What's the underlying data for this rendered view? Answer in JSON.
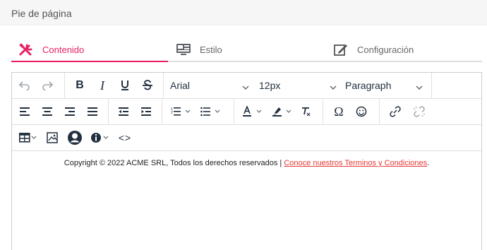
{
  "panel": {
    "title": "Pie de página"
  },
  "tabs": [
    {
      "label": "Contenido",
      "icon": "tools-icon",
      "active": true
    },
    {
      "label": "Estilo",
      "icon": "style-icon",
      "active": false
    },
    {
      "label": "Configuración",
      "icon": "edit-icon",
      "active": false
    }
  ],
  "toolbar": {
    "font_family": "Arial",
    "font_size": "12px",
    "block_format": "Paragraph",
    "bold_label": "B",
    "italic_label": "I",
    "omega_label": "Ω",
    "code_label": "<>"
  },
  "content": {
    "text": "Copyright © 2022 ACME SRL, Todos los derechos reservados | ",
    "link": "Conoce nuestros Terminos y Condiciones",
    "suffix": "."
  },
  "colors": {
    "accent": "#e91e63",
    "link": "#e53935"
  }
}
